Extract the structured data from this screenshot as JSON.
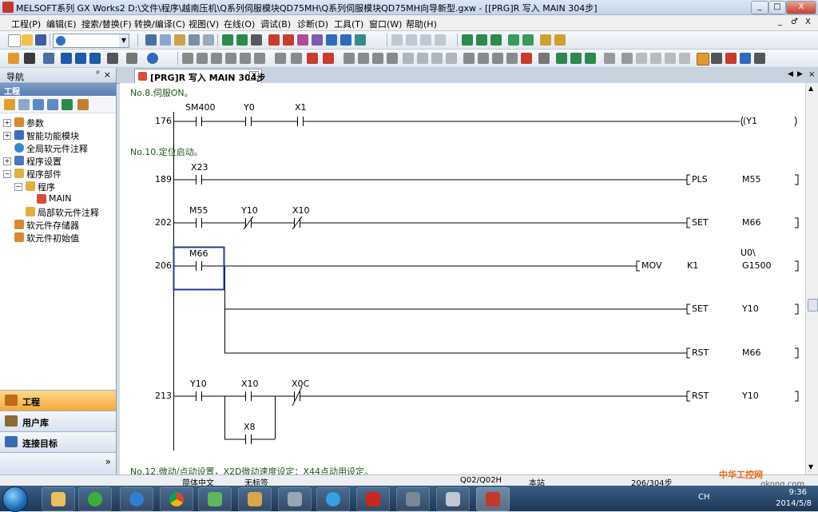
{
  "window": {
    "title": "MELSOFT系列 GX Works2 D:\\文件\\程序\\越南压机\\Q系列伺服模块QD75MH\\Q系列伺服模块QD75MH向导新型.gxw - [[PRG]R 写入 MAIN 304步]",
    "min": "_",
    "max": "□",
    "close": "X"
  },
  "menu": [
    "工程(P)",
    "编辑(E)",
    "搜索/替换(F)",
    "转换/编译(C)",
    "视图(V)",
    "在线(O)",
    "调试(B)",
    "诊断(D)",
    "工具(T)",
    "窗口(W)",
    "帮助(H)"
  ],
  "mdi_controls": [
    "_",
    "♂",
    "X"
  ],
  "navigation": {
    "title": "导航",
    "pin": "ᵖ",
    "close": "×",
    "section": "工程",
    "tree": [
      {
        "label": "参数"
      },
      {
        "label": "智能功能模块"
      },
      {
        "label": "全局软元件注释"
      },
      {
        "label": "程序设置"
      },
      {
        "label": "程序部件"
      },
      {
        "label": "程序"
      },
      {
        "label": "MAIN"
      },
      {
        "label": "局部软元件注释"
      },
      {
        "label": "软元件存储器"
      },
      {
        "label": "软元件初始值"
      }
    ],
    "buttons": [
      {
        "label": "工程"
      },
      {
        "label": "用户库"
      },
      {
        "label": "连接目标"
      }
    ],
    "more": "»"
  },
  "tab": {
    "label": "[PRG]R 写入 MAIN 304步",
    "close": "×"
  },
  "ladder": {
    "comments": [
      {
        "text": "No.8.伺服ON。"
      },
      {
        "text": "No.10.定位启动。"
      },
      {
        "text": "No.12.微动/点动设置，X2D微动速度设定：X44点动用设定。"
      }
    ],
    "steps": [
      "176",
      "189",
      "202",
      "206",
      "213"
    ],
    "contacts": [
      {
        "label": "SM400"
      },
      {
        "label": "Y0"
      },
      {
        "label": "X1"
      },
      {
        "label": "X23"
      },
      {
        "label": "M55"
      },
      {
        "label": "Y10"
      },
      {
        "label": "X10"
      },
      {
        "label": "M66"
      },
      {
        "label": "Y10"
      },
      {
        "label": "X10"
      },
      {
        "label": "X0C"
      },
      {
        "label": "X8"
      }
    ],
    "coils": [
      {
        "op": "(Y1",
        "a1": "",
        "a2": ""
      },
      {
        "op": "PLS",
        "a1": "M55",
        "a2": ""
      },
      {
        "op": "SET",
        "a1": "M66",
        "a2": ""
      },
      {
        "op": "MOV",
        "a1": "K1",
        "a2": "U0\\",
        "a3": "G1500"
      },
      {
        "op": "SET",
        "a1": "Y10",
        "a2": ""
      },
      {
        "op": "RST",
        "a1": "M66",
        "a2": ""
      },
      {
        "op": "RST",
        "a1": "Y10",
        "a2": ""
      }
    ]
  },
  "status": {
    "lang": "简体中文",
    "label": "无标签",
    "cpu": "Q02/Q02H",
    "station": "本站",
    "steps": "206/304步"
  },
  "taskbar": {
    "time": "9:36",
    "date": "2014/5/8",
    "ime": "CH"
  },
  "watermark": {
    "brand": "中华工控网",
    "site": "gkong.com"
  }
}
